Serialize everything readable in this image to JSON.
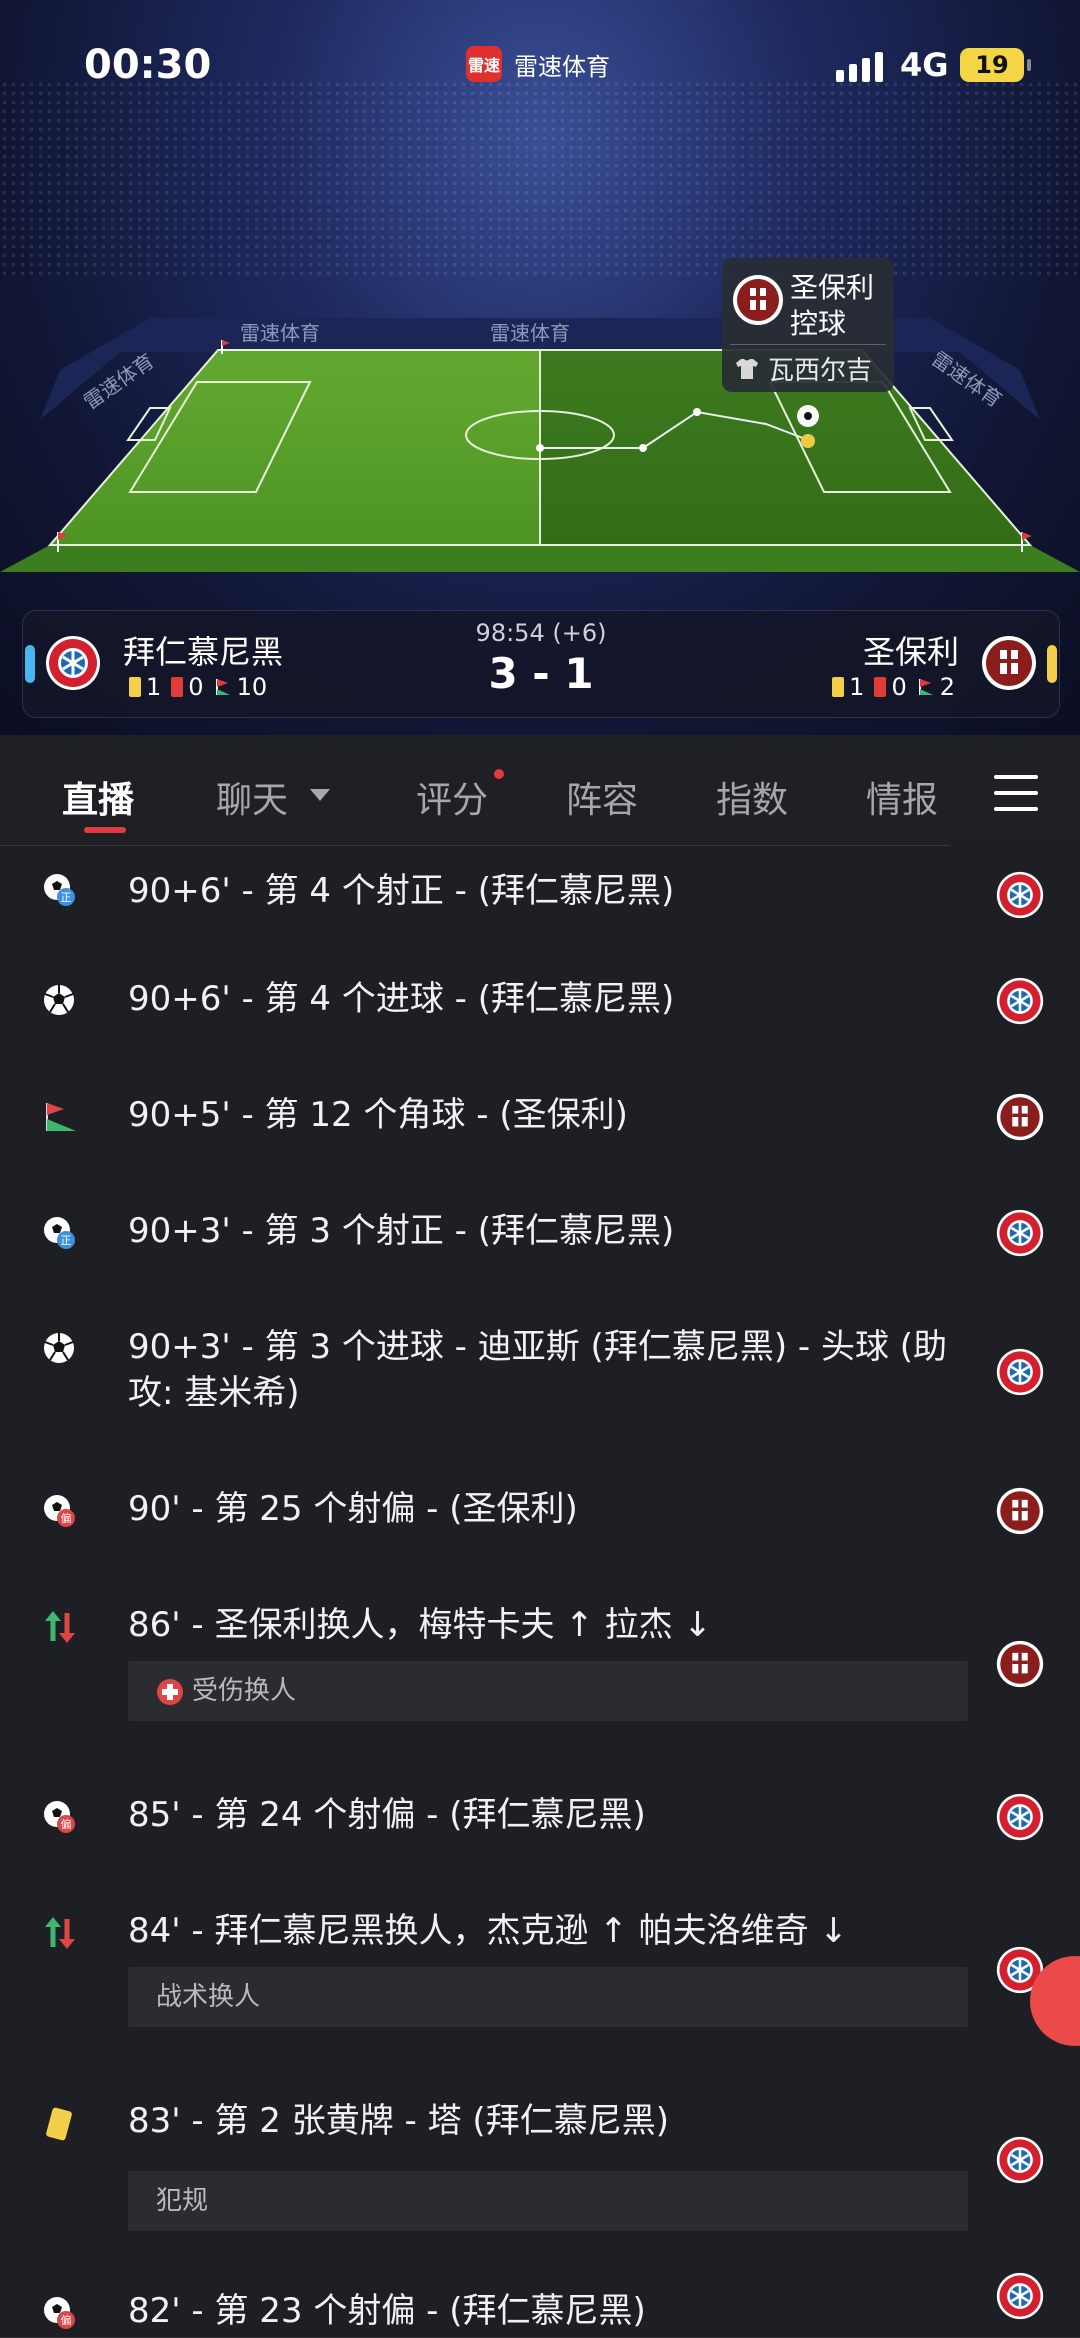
{
  "status_bar": {
    "time": "00:30",
    "network": "4G",
    "battery": "19"
  },
  "app": {
    "badge_text": "雷速",
    "name": "雷速体育"
  },
  "pitch": {
    "board_labels": [
      "雷速体育",
      "雷速体育",
      "雷速体育",
      "雷速体育"
    ],
    "possession": {
      "team": "圣保利",
      "status": "控球",
      "player": "瓦西尔吉"
    }
  },
  "match": {
    "clock": "98:54 (+6)",
    "score": "3 - 1",
    "home": {
      "name": "拜仁慕尼黑",
      "yellow": "1",
      "red": "0",
      "corners": "10",
      "accent": "#49b6f2"
    },
    "away": {
      "name": "圣保利",
      "yellow": "1",
      "red": "0",
      "corners": "2",
      "accent": "#f4cf4a"
    }
  },
  "tabs": [
    {
      "label": "直播"
    },
    {
      "label": "聊天"
    },
    {
      "label": "评分"
    },
    {
      "label": "阵容"
    },
    {
      "label": "指数"
    },
    {
      "label": "情报"
    }
  ],
  "events": [
    {
      "icon": "shot-on-target-icon",
      "team": "home",
      "text": "90+6' - 第 4 个射正 - (拜仁慕尼黑)"
    },
    {
      "icon": "goal-icon",
      "team": "home",
      "text": "90+6' - 第 4 个进球 - (拜仁慕尼黑)"
    },
    {
      "icon": "corner-flag-icon",
      "team": "away",
      "text": "90+5' - 第 12 个角球 - (圣保利)"
    },
    {
      "icon": "shot-on-target-icon",
      "team": "home",
      "text": "90+3' - 第 3 个射正 - (拜仁慕尼黑)"
    },
    {
      "icon": "goal-icon",
      "team": "home",
      "text": "90+3' - 第 3 个进球 - 迪亚斯 (拜仁慕尼黑) - 头球 (助攻: 基米希)"
    },
    {
      "icon": "shot-off-target-icon",
      "team": "away",
      "text": "90' - 第 25 个射偏 - (圣保利)"
    },
    {
      "icon": "substitution-icon",
      "team": "away",
      "text": "86' - 圣保利换人，梅特卡夫 ↑ 拉杰 ↓",
      "note": "受伤换人"
    },
    {
      "icon": "shot-off-target-icon",
      "team": "home",
      "text": "85' - 第 24 个射偏 - (拜仁慕尼黑)"
    },
    {
      "icon": "substitution-icon",
      "team": "home",
      "text": "84' - 拜仁慕尼黑换人，杰克逊 ↑ 帕夫洛维奇 ↓",
      "note": "战术换人"
    },
    {
      "icon": "yellow-card-icon",
      "team": "home",
      "text": "83' - 第 2 张黄牌 - 塔 (拜仁慕尼黑)",
      "note": "犯规"
    },
    {
      "icon": "shot-off-target-icon",
      "team": "home",
      "text": "82' - 第 23 个射偏 - (拜仁慕尼黑)"
    }
  ]
}
